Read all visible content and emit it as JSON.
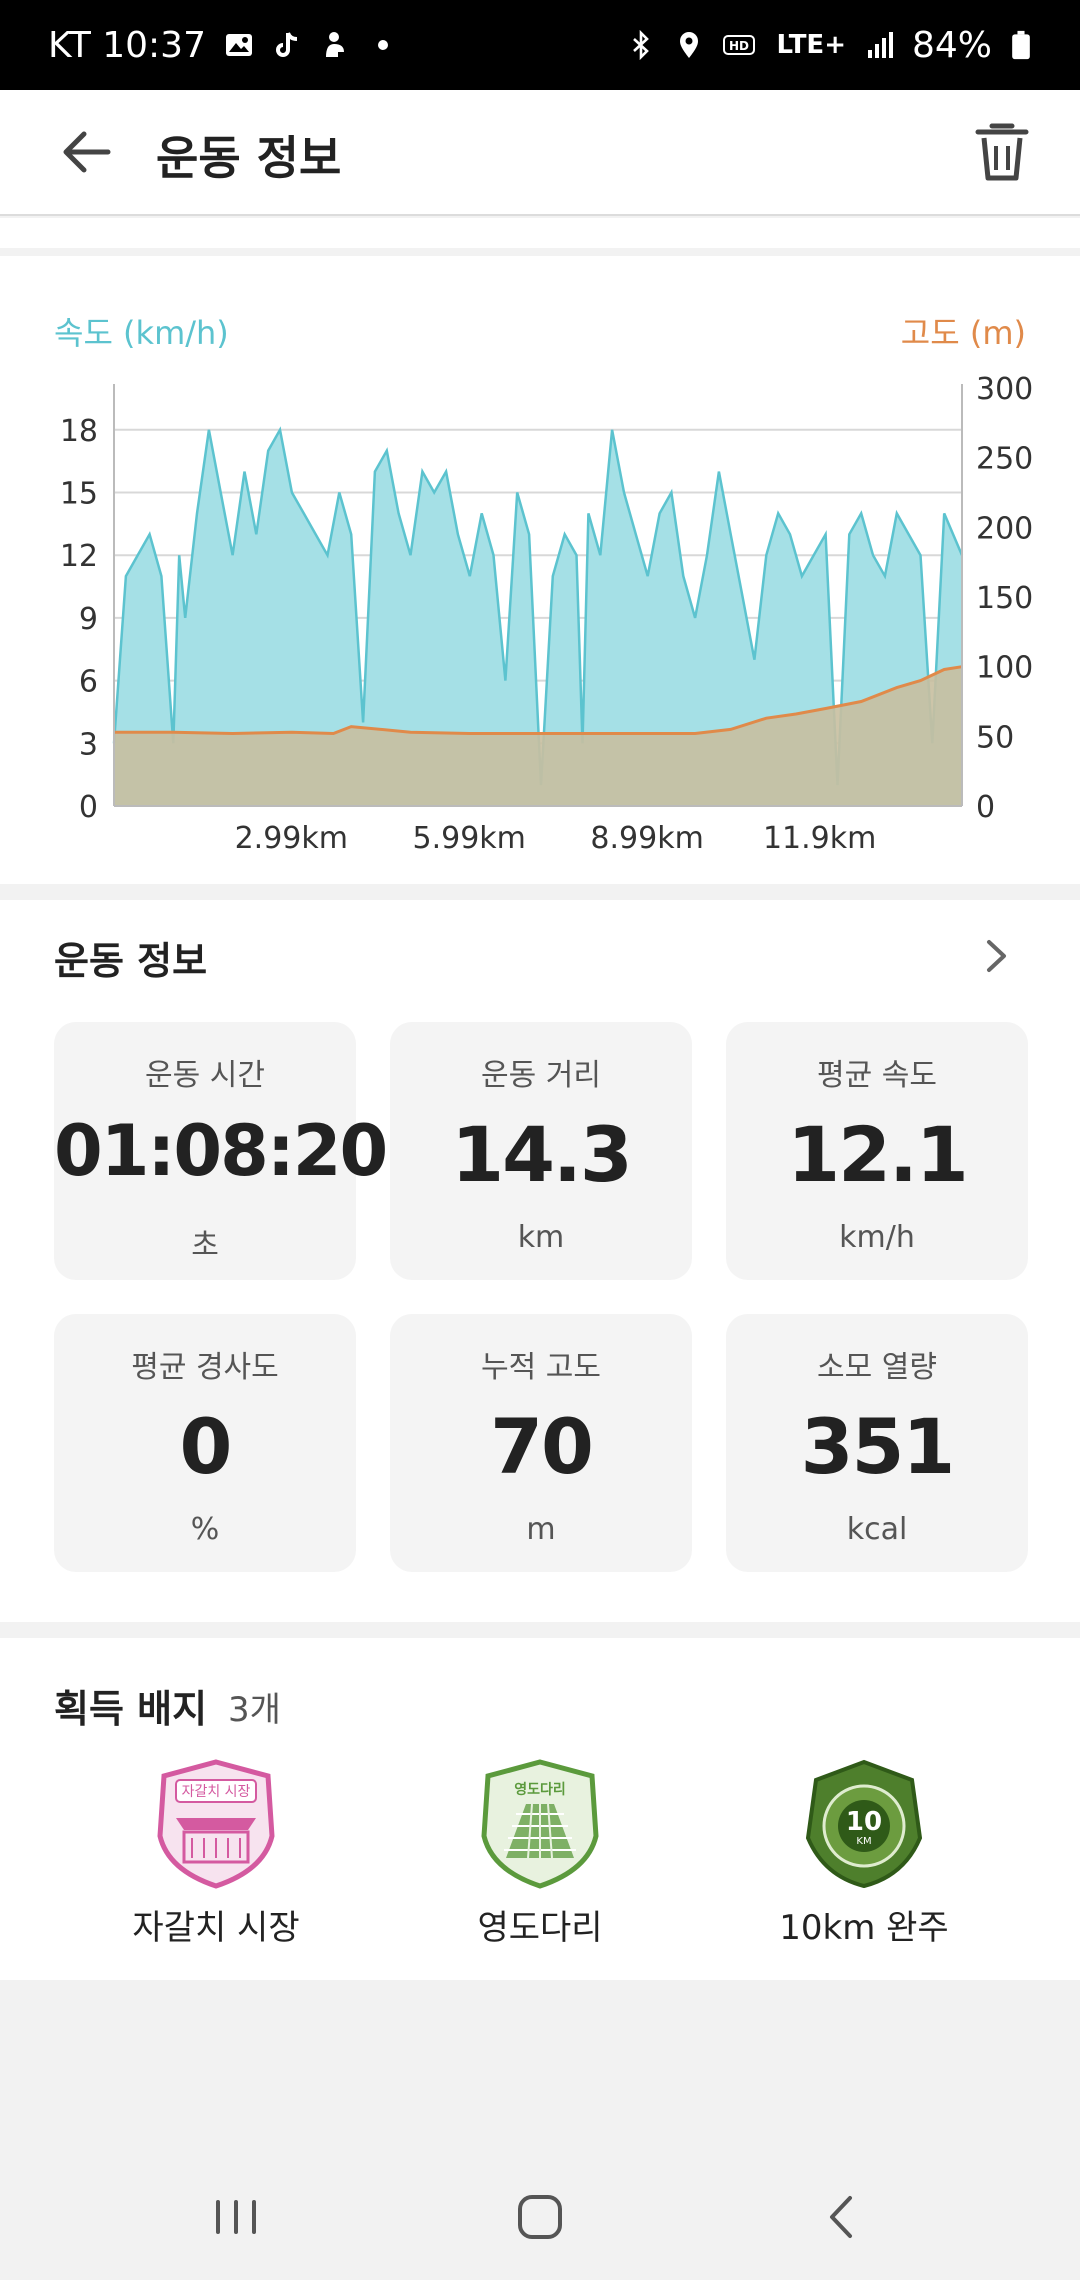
{
  "status_bar": {
    "carrier_time": "KT 10:37",
    "network": "LTE+",
    "battery": "84%"
  },
  "app_bar": {
    "title": "운동 정보"
  },
  "chart": {
    "left_axis_label": "속도 (km/h)",
    "right_axis_label": "고도 (m)",
    "colors": {
      "speed": "#5cc3cf",
      "speed_fill": "#a5e0e6",
      "altitude": "#e08a4a",
      "altitude_fill": "#c8bfa0"
    }
  },
  "chart_data": {
    "type": "area",
    "xlabel": "",
    "x_ticks": [
      "2.99km",
      "5.99km",
      "8.99km",
      "11.9km"
    ],
    "x_tick_values": [
      2.99,
      5.99,
      8.99,
      11.9
    ],
    "xlim": [
      0,
      14.3
    ],
    "y_left": {
      "label": "속도 (km/h)",
      "ticks": [
        0,
        3,
        6,
        9,
        12,
        15,
        18
      ],
      "lim": [
        0,
        20
      ]
    },
    "y_right": {
      "label": "고도 (m)",
      "ticks": [
        0,
        50,
        100,
        150,
        200,
        250,
        300
      ],
      "lim": [
        0,
        300
      ]
    },
    "grid": true,
    "series": [
      {
        "name": "속도 (km/h)",
        "axis": "left",
        "x": [
          0,
          0.2,
          0.4,
          0.6,
          0.8,
          1.0,
          1.1,
          1.2,
          1.4,
          1.6,
          1.8,
          2.0,
          2.2,
          2.4,
          2.6,
          2.8,
          3.0,
          3.2,
          3.4,
          3.6,
          3.8,
          4.0,
          4.2,
          4.4,
          4.6,
          4.8,
          5.0,
          5.2,
          5.4,
          5.6,
          5.8,
          6.0,
          6.2,
          6.4,
          6.6,
          6.8,
          7.0,
          7.2,
          7.4,
          7.6,
          7.8,
          7.9,
          8.0,
          8.2,
          8.4,
          8.6,
          8.8,
          9.0,
          9.2,
          9.4,
          9.6,
          9.8,
          10.0,
          10.2,
          10.4,
          10.6,
          10.8,
          11.0,
          11.2,
          11.4,
          11.6,
          11.8,
          12.0,
          12.2,
          12.4,
          12.6,
          12.8,
          13.0,
          13.2,
          13.4,
          13.6,
          13.8,
          14.0,
          14.3
        ],
        "values": [
          3,
          11,
          12,
          13,
          11,
          3,
          12,
          9,
          14,
          18,
          15,
          12,
          16,
          13,
          17,
          18,
          15,
          14,
          13,
          12,
          15,
          13,
          4,
          16,
          17,
          14,
          12,
          16,
          15,
          16,
          13,
          11,
          14,
          12,
          6,
          15,
          13,
          1,
          11,
          13,
          12,
          3,
          14,
          12,
          18,
          15,
          13,
          11,
          14,
          15,
          11,
          9,
          12,
          16,
          13,
          10,
          7,
          12,
          14,
          13,
          11,
          12,
          13,
          1,
          13,
          14,
          12,
          11,
          14,
          13,
          12,
          3,
          14,
          12
        ]
      },
      {
        "name": "고도 (m)",
        "axis": "right",
        "x": [
          0,
          1,
          2,
          3,
          3.7,
          4.0,
          5,
          6,
          7,
          8,
          9,
          9.8,
          10.4,
          11,
          11.5,
          12,
          12.6,
          13.2,
          13.6,
          14.0,
          14.3
        ],
        "values": [
          53,
          53,
          52,
          53,
          52,
          57,
          53,
          52,
          52,
          52,
          52,
          52,
          55,
          63,
          66,
          70,
          75,
          85,
          90,
          98,
          100
        ]
      }
    ]
  },
  "metrics": {
    "section_title": "운동 정보",
    "tiles": [
      {
        "label": "운동 시간",
        "value": "01:08:20",
        "unit": "초"
      },
      {
        "label": "운동 거리",
        "value": "14.3",
        "unit": "km"
      },
      {
        "label": "평균 속도",
        "value": "12.1",
        "unit": "km/h"
      },
      {
        "label": "평균 경사도",
        "value": "0",
        "unit": "%"
      },
      {
        "label": "누적 고도",
        "value": "70",
        "unit": "m"
      },
      {
        "label": "소모 열량",
        "value": "351",
        "unit": "kcal"
      }
    ]
  },
  "badges": {
    "section_title": "획득 배지",
    "count": "3개",
    "items": [
      {
        "name": "자갈치 시장",
        "emblem_text": "자갈치 시장",
        "color": "#d45aa0",
        "icon": "market-badge-icon"
      },
      {
        "name": "영도다리",
        "emblem_text": "영도다리",
        "color": "#5b9a3c",
        "icon": "bridge-badge-icon"
      },
      {
        "name": "10km 완주",
        "emblem_text": "10",
        "emblem_sub": "KM",
        "color": "#4e7f2c",
        "icon": "cycling-10km-badge-icon"
      }
    ]
  }
}
